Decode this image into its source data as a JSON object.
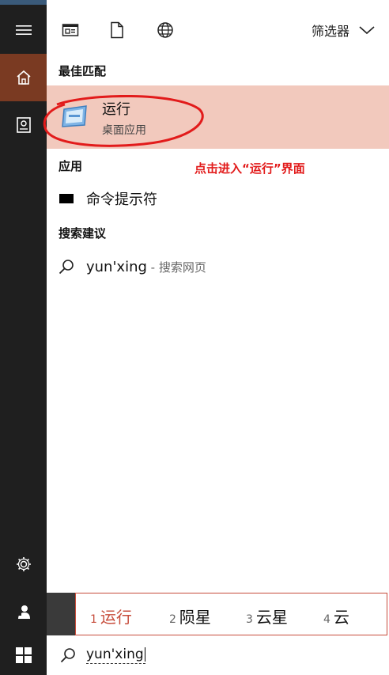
{
  "rail": {
    "items": [
      {
        "name": "menu-icon"
      },
      {
        "name": "home-icon",
        "active": true
      },
      {
        "name": "notebook-icon"
      },
      {
        "name": "settings-icon"
      },
      {
        "name": "user-icon"
      }
    ]
  },
  "topbar": {
    "filter_label": "筛选器"
  },
  "sections": {
    "best_match": "最佳匹配",
    "apps": "应用",
    "suggestions": "搜索建议"
  },
  "best_match_item": {
    "title": "运行",
    "subtitle": "桌面应用"
  },
  "annotation": {
    "text": "点击进入“运行”界面",
    "color": "#e21b1b"
  },
  "apps": [
    {
      "label": "命令提示符"
    }
  ],
  "suggestions": [
    {
      "query": "yun'xing",
      "suffix": " - 搜索网页"
    }
  ],
  "ime": {
    "candidates": [
      {
        "num": "1",
        "text": "运行"
      },
      {
        "num": "2",
        "text": "陨星"
      },
      {
        "num": "3",
        "text": "云星"
      },
      {
        "num": "4",
        "text": "云"
      }
    ]
  },
  "searchbox": {
    "value": "yun'xing"
  },
  "colors": {
    "accent": "#7a3a22",
    "highlight": "#f2c9bd",
    "ime_selected": "#c74d3c"
  }
}
